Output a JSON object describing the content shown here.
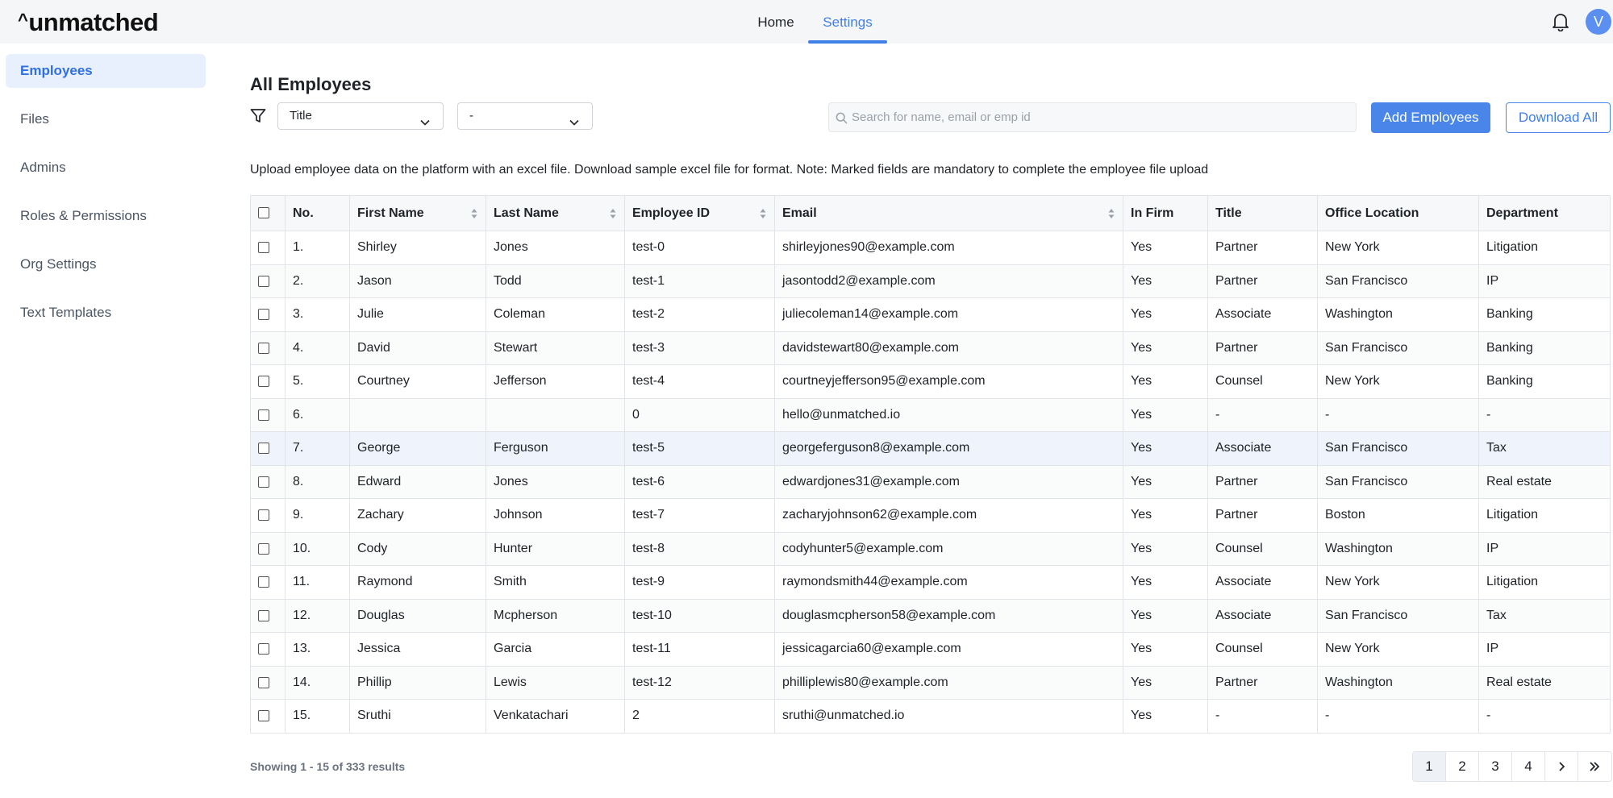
{
  "header": {
    "logo": "unmatched",
    "logo_mark": "^",
    "nav": [
      {
        "label": "Home",
        "active": false
      },
      {
        "label": "Settings",
        "active": true
      }
    ],
    "avatar_initial": "V",
    "accent_color": "#3f7fe8"
  },
  "sidebar": {
    "items": [
      {
        "label": "Employees",
        "active": true
      },
      {
        "label": "Files",
        "active": false
      },
      {
        "label": "Admins",
        "active": false
      },
      {
        "label": "Roles & Permissions",
        "active": false
      },
      {
        "label": "Org Settings",
        "active": false
      },
      {
        "label": "Text Templates",
        "active": false
      }
    ]
  },
  "main": {
    "title": "All Employees",
    "filter_field": "Title",
    "filter_value": "-",
    "search_placeholder": "Search for name, email or emp id",
    "add_button": "Add Employees",
    "download_button": "Download All",
    "note": "Upload employee data on the platform with an excel file. Download sample excel file for format. Note: Marked fields are mandatory to complete the employee file upload"
  },
  "table": {
    "columns": [
      {
        "label": "No.",
        "sortable": false
      },
      {
        "label": "First Name",
        "sortable": true
      },
      {
        "label": "Last Name",
        "sortable": true
      },
      {
        "label": "Employee ID",
        "sortable": true
      },
      {
        "label": "Email",
        "sortable": true
      },
      {
        "label": "In Firm",
        "sortable": false
      },
      {
        "label": "Title",
        "sortable": false
      },
      {
        "label": "Office Location",
        "sortable": false
      },
      {
        "label": "Department",
        "sortable": false
      }
    ],
    "rows": [
      [
        "1.",
        "Shirley",
        "Jones",
        "test-0",
        "shirleyjones90@example.com",
        "Yes",
        "Partner",
        "New York",
        "Litigation"
      ],
      [
        "2.",
        "Jason",
        "Todd",
        "test-1",
        "jasontodd2@example.com",
        "Yes",
        "Partner",
        "San Francisco",
        "IP"
      ],
      [
        "3.",
        "Julie",
        "Coleman",
        "test-2",
        "juliecoleman14@example.com",
        "Yes",
        "Associate",
        "Washington",
        "Banking"
      ],
      [
        "4.",
        "David",
        "Stewart",
        "test-3",
        "davidstewart80@example.com",
        "Yes",
        "Partner",
        "San Francisco",
        "Banking"
      ],
      [
        "5.",
        "Courtney",
        "Jefferson",
        "test-4",
        "courtneyjefferson95@example.com",
        "Yes",
        "Counsel",
        "New York",
        "Banking"
      ],
      [
        "6.",
        "",
        "",
        "0",
        "hello@unmatched.io",
        "Yes",
        "-",
        "-",
        "-"
      ],
      [
        "7.",
        "George",
        "Ferguson",
        "test-5",
        "georgeferguson8@example.com",
        "Yes",
        "Associate",
        "San Francisco",
        "Tax"
      ],
      [
        "8.",
        "Edward",
        "Jones",
        "test-6",
        "edwardjones31@example.com",
        "Yes",
        "Partner",
        "San Francisco",
        "Real estate"
      ],
      [
        "9.",
        "Zachary",
        "Johnson",
        "test-7",
        "zacharyjohnson62@example.com",
        "Yes",
        "Partner",
        "Boston",
        "Litigation"
      ],
      [
        "10.",
        "Cody",
        "Hunter",
        "test-8",
        "codyhunter5@example.com",
        "Yes",
        "Counsel",
        "Washington",
        "IP"
      ],
      [
        "11.",
        "Raymond",
        "Smith",
        "test-9",
        "raymondsmith44@example.com",
        "Yes",
        "Associate",
        "New York",
        "Litigation"
      ],
      [
        "12.",
        "Douglas",
        "Mcpherson",
        "test-10",
        "douglasmcpherson58@example.com",
        "Yes",
        "Associate",
        "San Francisco",
        "Tax"
      ],
      [
        "13.",
        "Jessica",
        "Garcia",
        "test-11",
        "jessicagarcia60@example.com",
        "Yes",
        "Counsel",
        "New York",
        "IP"
      ],
      [
        "14.",
        "Phillip",
        "Lewis",
        "test-12",
        "philliplewis80@example.com",
        "Yes",
        "Partner",
        "Washington",
        "Real estate"
      ],
      [
        "15.",
        "Sruthi",
        "Venkatachari",
        "2",
        "sruthi@unmatched.io",
        "Yes",
        "-",
        "-",
        "-"
      ]
    ],
    "highlighted_row": 7
  },
  "footer": {
    "showing": "Showing 1 - 15 of 333 results",
    "pages": [
      "1",
      "2",
      "3",
      "4"
    ],
    "current_page": "1"
  }
}
